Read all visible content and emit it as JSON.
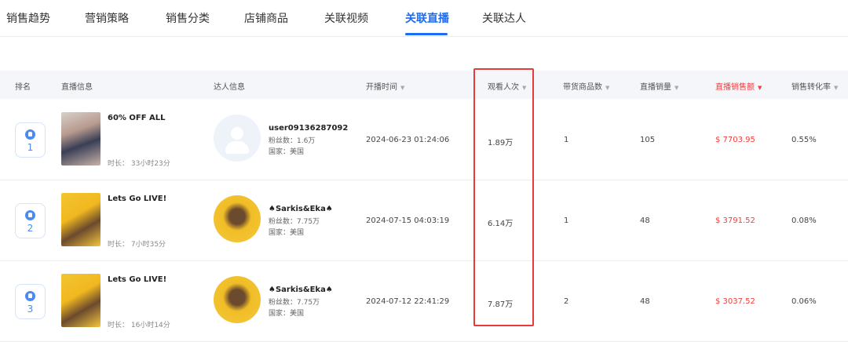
{
  "tabs": [
    {
      "label": "销售趋势"
    },
    {
      "label": "营销策略"
    },
    {
      "label": "销售分类"
    },
    {
      "label": "店铺商品"
    },
    {
      "label": "关联视频"
    },
    {
      "label": "关联直播"
    },
    {
      "label": "关联达人"
    }
  ],
  "active_tab": "关联直播",
  "table": {
    "columns": [
      {
        "label": "排名"
      },
      {
        "label": "直播信息"
      },
      {
        "label": "达人信息"
      },
      {
        "label": "开播时间",
        "sort": "▼"
      },
      {
        "label": "观看人次",
        "sort": "▼"
      },
      {
        "label": "带货商品数",
        "sort": "▼"
      },
      {
        "label": "直播销量",
        "sort": "▼"
      },
      {
        "label": "直播销售额",
        "sort": "▼"
      },
      {
        "label": "销售转化率",
        "sort": "▼"
      }
    ],
    "rows": [
      {
        "rank": "1",
        "live_title": "60% OFF ALL",
        "duration": "时长： 33小时23分",
        "influencer_name": "user09136287092",
        "followers": "粉丝数：1.6万",
        "country": "国家：美国",
        "start_time": "2024-06-23 01:24:06",
        "views": "1.89万",
        "product_count": "1",
        "live_sales": "105",
        "revenue": "$ 7703.95",
        "conversion": "0.55%"
      },
      {
        "rank": "2",
        "live_title": "Lets Go LIVE!",
        "duration": "时长： 7小时35分",
        "influencer_name": "♠Sarkis&Eka♠",
        "followers": "粉丝数：7.75万",
        "country": "国家：美国",
        "start_time": "2024-07-15 04:03:19",
        "views": "6.14万",
        "product_count": "1",
        "live_sales": "48",
        "revenue": "$ 3791.52",
        "conversion": "0.08%"
      },
      {
        "rank": "3",
        "live_title": "Lets Go LIVE!",
        "duration": "时长： 16小时14分",
        "influencer_name": "♠Sarkis&Eka♠",
        "followers": "粉丝数：7.75万",
        "country": "国家：美国",
        "start_time": "2024-07-12 22:41:29",
        "views": "7.87万",
        "product_count": "2",
        "live_sales": "48",
        "revenue": "$ 3037.52",
        "conversion": "0.06%"
      }
    ]
  },
  "colors": {
    "accent": "#1b6cf2",
    "revenue": "#f03e3e",
    "highlight": "#e83a3a"
  }
}
